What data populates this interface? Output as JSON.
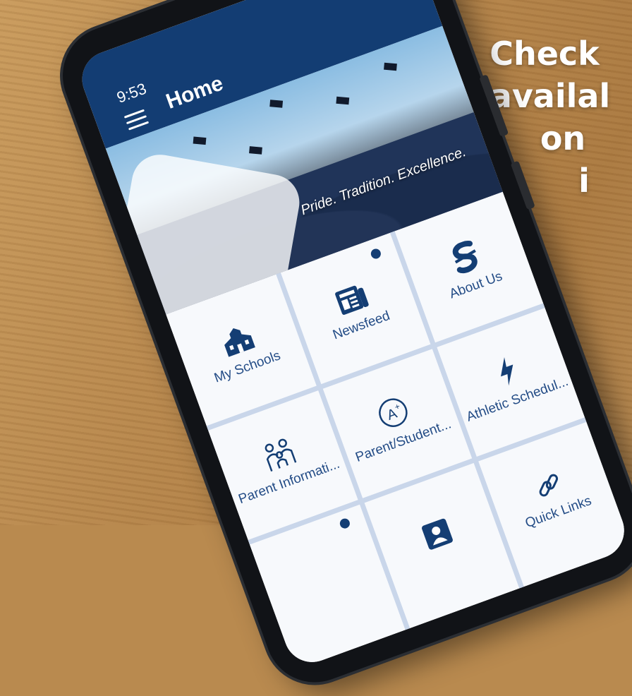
{
  "overlay": {
    "lines": [
      "Check",
      "availal",
      "on",
      "i"
    ]
  },
  "status_bar": {
    "time": "9:53"
  },
  "app_bar": {
    "title": "Home"
  },
  "hero": {
    "motto": "Pride. Tradition. Excellence."
  },
  "tiles": [
    {
      "label": "About Us",
      "icon": "school-logo-icon"
    },
    {
      "label": "Newsfeed",
      "icon": "newspaper-icon"
    },
    {
      "label": "My Schools",
      "icon": "school-building-icon"
    },
    {
      "label": "Athletic Schedul...",
      "icon": "lightning-bolt-icon"
    },
    {
      "label": "Parent/Student...",
      "icon": "a-plus-icon"
    },
    {
      "label": "Parent Informati...",
      "icon": "family-icon"
    },
    {
      "label": "Quick Links",
      "icon": "link-icon"
    },
    {
      "label": "",
      "icon": "contact-card-icon"
    }
  ],
  "colors": {
    "app_bar": "#133d73",
    "tile_text": "#234c86",
    "grid_lines": "#c9d6ea"
  }
}
